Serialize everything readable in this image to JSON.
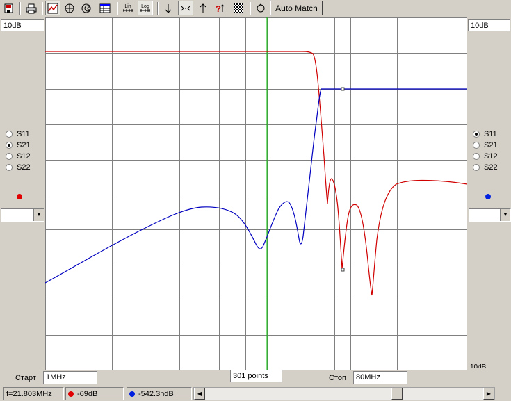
{
  "toolbar": {
    "icons": [
      "save-icon",
      "print-icon",
      "chart-rect-icon",
      "polar-grid-icon",
      "smith-chart-icon",
      "table-icon",
      "lin-scale-icon",
      "log-scale-icon",
      "marker-down-icon",
      "zoom-in-icon",
      "marker-up-icon",
      "help-icon",
      "dither-icon",
      "reset-icon"
    ],
    "lin_label": "Lin",
    "log_label": "Log",
    "auto_match_label": "Auto Match"
  },
  "left_panel": {
    "scale": "10dB",
    "params": [
      "S11",
      "S21",
      "S12",
      "S22"
    ],
    "selected": "S21",
    "trace_color": "#e00000"
  },
  "right_panel": {
    "scale": "10dB",
    "params": [
      "S11",
      "S21",
      "S12",
      "S22"
    ],
    "selected": "S11",
    "trace_color": "#0020e0",
    "bottom_label": "10dB"
  },
  "bottom_bar": {
    "start_label": "Старт",
    "start_value": "1MHz",
    "points_value": "301 points",
    "stop_label": "Стоп",
    "stop_value": "80MHz"
  },
  "status": {
    "frequency": "f=21.803MHz",
    "trace1_value": "-69dB",
    "trace1_color": "#e00000",
    "trace2_value": "-542.3ndB",
    "trace2_color": "#0020e0"
  },
  "chart_data": {
    "type": "line",
    "x_range_mhz": [
      1,
      80
    ],
    "marker_mhz": 21.803,
    "grid": true,
    "series": [
      {
        "color": "#d00000"
      },
      {
        "color": "#0000c0"
      }
    ]
  }
}
